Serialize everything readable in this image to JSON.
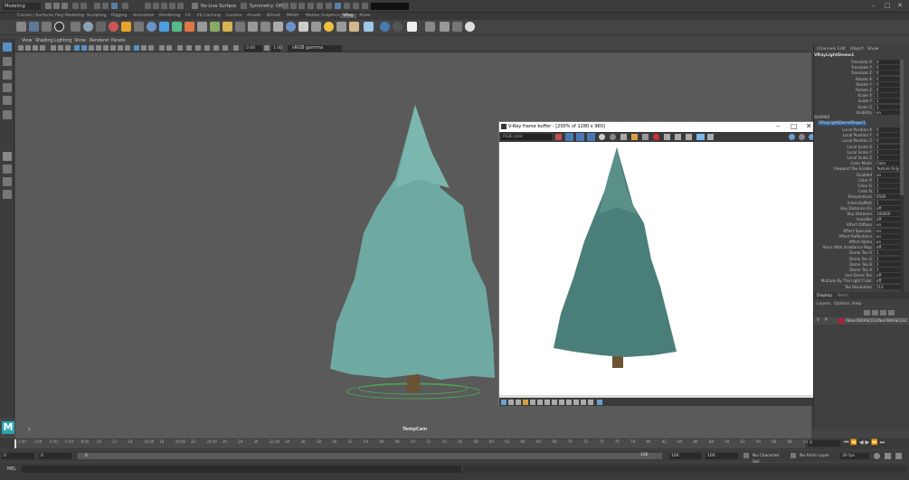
{
  "statusline": {
    "mode": "Modeling",
    "no_live_surface": "No Live Surface",
    "symmetry": "Symmetry: Off",
    "window_controls": [
      "–",
      "□",
      "✕"
    ]
  },
  "shelf_tabs": [
    "Curves / Surfaces",
    "Poly Modeling",
    "Sculpting",
    "Rigging",
    "Animation",
    "Rendering",
    "FX",
    "FX Caching",
    "Custom",
    "Arnold",
    "Bifrost",
    "MASH",
    "Motion Graphics",
    "VRay",
    "XGen"
  ],
  "shelf_active": "VRay",
  "viewport": {
    "menu": [
      "View",
      "Shading",
      "Lighting",
      "Show",
      "Renderer",
      "Panels"
    ],
    "exposure": "0.00",
    "gamma": "1.00",
    "color_space": "sRGB gamma",
    "camera_label": "TempCam"
  },
  "vfb": {
    "title": "V-Ray frame buffer - [200% of 1280 x 960]",
    "channel": "RGB color"
  },
  "channel_box": {
    "tabs": [
      "Channels",
      "Edit",
      "Object",
      "Show"
    ],
    "node": "VRayLightDome1",
    "transform_attrs": [
      {
        "name": "Translate X",
        "value": "0"
      },
      {
        "name": "Translate Y",
        "value": "0"
      },
      {
        "name": "Translate Z",
        "value": "0"
      },
      {
        "name": "Rotate X",
        "value": "0"
      },
      {
        "name": "Rotate Y",
        "value": "0"
      },
      {
        "name": "Rotate Z",
        "value": "0"
      },
      {
        "name": "Scale X",
        "value": "1"
      },
      {
        "name": "Scale Y",
        "value": "1"
      },
      {
        "name": "Scale Z",
        "value": "1"
      },
      {
        "name": "Visibility",
        "value": "on"
      }
    ],
    "shapes_label": "SHAPES",
    "shape_node": "VRayLightDomeShape1",
    "shape_attrs": [
      {
        "name": "Local Position X",
        "value": "0"
      },
      {
        "name": "Local Position Y",
        "value": "0"
      },
      {
        "name": "Local Position Z",
        "value": "0"
      },
      {
        "name": "Local Scale X",
        "value": "1"
      },
      {
        "name": "Local Scale Y",
        "value": "1"
      },
      {
        "name": "Local Scale Z",
        "value": "1"
      },
      {
        "name": "Color Mode",
        "value": "Color"
      },
      {
        "name": "Viewport Tex Enable",
        "value": "Texture Only"
      },
      {
        "name": "Enabled",
        "value": "on"
      },
      {
        "name": "Color R",
        "value": "1"
      },
      {
        "name": "Color G",
        "value": "1"
      },
      {
        "name": "Color B",
        "value": "1"
      },
      {
        "name": "Temperature",
        "value": "6500"
      },
      {
        "name": "IntensityMult",
        "value": "1"
      },
      {
        "name": "Ray Distance On",
        "value": "off"
      },
      {
        "name": "Ray Distance",
        "value": "100000"
      },
      {
        "name": "Invisible",
        "value": "off"
      },
      {
        "name": "Affect Diffuse",
        "value": "on"
      },
      {
        "name": "Affect Specular",
        "value": "on"
      },
      {
        "name": "Affect Reflections",
        "value": "on"
      },
      {
        "name": "Affect Alpha",
        "value": "on"
      },
      {
        "name": "Store With Irradiance Map",
        "value": "off"
      },
      {
        "name": "Dome Tex R",
        "value": "1"
      },
      {
        "name": "Dome Tex G",
        "value": "1"
      },
      {
        "name": "Dome Tex B",
        "value": "1"
      },
      {
        "name": "Dome Tex A",
        "value": "1"
      },
      {
        "name": "Use Dome Tex",
        "value": "off"
      },
      {
        "name": "Multiply By The Light Color",
        "value": "off"
      },
      {
        "name": "Tex Resolution",
        "value": "512"
      }
    ],
    "layer_tabs": [
      "Display",
      "Anim"
    ],
    "layer_menu": [
      "Layers",
      "Options",
      "Help"
    ],
    "layer_flags": [
      "V",
      "P"
    ],
    "layer_name": "AbiesFBXASC032NorFBXASC032..."
  },
  "timeline": {
    "ticks": [
      "1.00",
      "2.60",
      "4.50",
      "6.00",
      "8.00",
      "10",
      "12",
      "14",
      "16.00",
      "18",
      "20.00",
      "22",
      "24.00",
      "26",
      "28",
      "30",
      "32.00",
      "34",
      "36",
      "38",
      "40",
      "42",
      "44",
      "46",
      "48",
      "50",
      "52",
      "54",
      "56",
      "58",
      "60",
      "62",
      "64",
      "66",
      "68",
      "70",
      "72",
      "74",
      "76",
      "78",
      "80",
      "82",
      "84",
      "86",
      "88",
      "90",
      "92",
      "94",
      "96",
      "98",
      "100"
    ],
    "current_frame": "0"
  },
  "range": {
    "start": "0",
    "start_inner": "0",
    "mid_val": "0",
    "end_inner": "100",
    "end": "100",
    "end2": "100",
    "character_set": "No Character Set",
    "anim_layer": "No Anim Layer",
    "fps": "30 fps"
  },
  "mel": {
    "label": "MEL"
  },
  "colors": {
    "tree": "#6faaa2",
    "vfb_tree": "#4a7e78",
    "trunk": "#6b5233",
    "accent": "#5a9bd5"
  }
}
